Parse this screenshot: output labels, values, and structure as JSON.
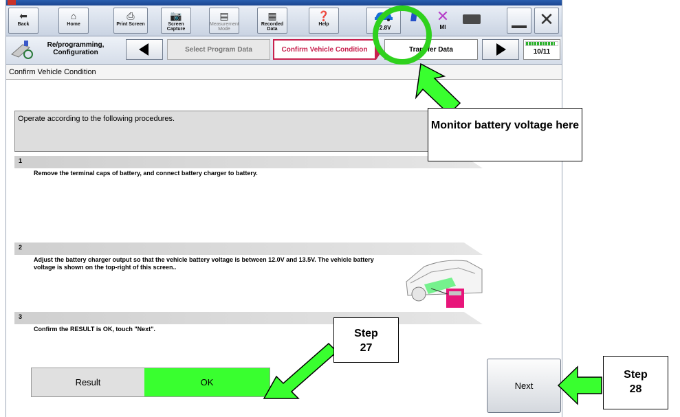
{
  "toolbar": {
    "buttons": [
      {
        "label": "Back"
      },
      {
        "label": "Home"
      },
      {
        "label": "Print Screen"
      },
      {
        "label": "Screen Capture"
      },
      {
        "label": "Measurement Mode"
      },
      {
        "label": "Recorded Data"
      },
      {
        "label": "Help"
      }
    ],
    "status": {
      "battery_voltage": "12.8V",
      "vi_status": "",
      "mi_status": "MI"
    }
  },
  "nav": {
    "reprogramming_label": "Re/programming, Configuration",
    "crumbs": [
      {
        "label": "Select Program Data",
        "state": "done"
      },
      {
        "label": "Confirm Vehicle Condition",
        "state": "current"
      },
      {
        "label": "Transfer Data",
        "state": "next"
      }
    ],
    "progress_text": "10/11",
    "progress_ratio": 0.91
  },
  "section_title": "Confirm Vehicle Condition",
  "procedure_header": "Operate according to the following procedures.",
  "steps": [
    {
      "number": "1",
      "text": "Remove the terminal caps of battery, and connect battery charger to battery."
    },
    {
      "number": "2",
      "text": "Adjust the battery charger output so that the vehicle battery voltage is between 12.0V and 13.5V. The vehicle battery voltage is shown on the top-right of this screen.."
    },
    {
      "number": "3",
      "text": "Confirm the RESULT is OK, touch \"Next\"."
    }
  ],
  "result": {
    "label": "Result",
    "value": "OK"
  },
  "next_label": "Next",
  "callouts": {
    "monitor": "Monitor battery voltage here",
    "step27": "Step 27",
    "step28": "Step 28"
  },
  "colors": {
    "accent_green": "#39ff2f",
    "current_step": "#c8204e",
    "callout_ring": "#2fd11d"
  }
}
